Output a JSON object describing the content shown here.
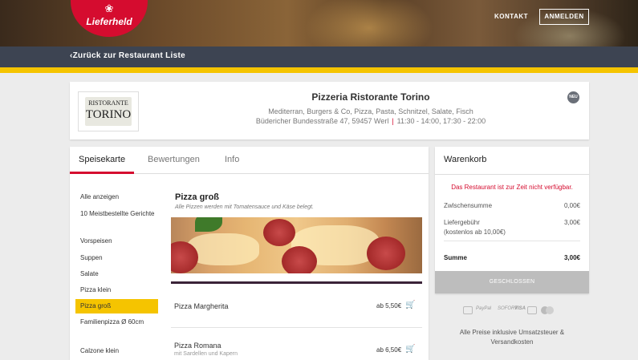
{
  "header": {
    "logo_text": "Lieferheld",
    "nav_kontakt": "KONTAKT",
    "nav_anmelden": "ANMELDEN",
    "back_link": "Zurück  zur  Restaurant  Liste",
    "accent_color": "#d50c2f",
    "highlight_color": "#f5c400"
  },
  "restaurant": {
    "logo_top": "RISTORANTE",
    "logo_main": "TORINO",
    "name": "Pizzeria Ristorante Torino",
    "tags": "Mediterran, Burgers & Co, Pizza, Pasta, Schnitzel, Salate, Fisch",
    "address": "Büdericher Bundesstraße 47, 59457 Werl",
    "hours": "11:30 - 14:00, 17:30 - 22:00",
    "new_badge": "NEU"
  },
  "tabs": [
    {
      "label": "Speisekarte"
    },
    {
      "label": "Bewertungen"
    },
    {
      "label": "Info"
    }
  ],
  "categories": [
    {
      "label": "Alle anzeigen"
    },
    {
      "label": "10 Meistbestellte Gerichte"
    },
    {
      "label": "Vorspeisen"
    },
    {
      "label": "Suppen"
    },
    {
      "label": "Salate"
    },
    {
      "label": "Pizza klein"
    },
    {
      "label": "Pizza groß"
    },
    {
      "label": "Familienpizza Ø 60cm"
    },
    {
      "label": "Calzone klein"
    }
  ],
  "section": {
    "title": "Pizza groß",
    "description": "Alle Pizzen werden mit Tomatensauce und Käse belegt."
  },
  "items": [
    {
      "name": "Pizza Margherita",
      "sub": "",
      "price": "ab 5,50€"
    },
    {
      "name": "Pizza Romana",
      "sub": "mit Sardellen und Kapern",
      "price": "ab 6,50€"
    }
  ],
  "cart": {
    "title": "Warenkorb",
    "closed_message": "Das Restaurant ist zur Zeit nicht verfügbar.",
    "subtotal_label": "Zwlschensumme",
    "subtotal_value": "0,00€",
    "delivery_label": "Liefergebühr",
    "delivery_sub": "(kostenlos ab 10,00€)",
    "delivery_value": "3,00€",
    "sum_label": "Summe",
    "sum_value": "3,00€",
    "button_label": "GESCHLOSSEN"
  },
  "payments": {
    "paypal": "PayPal",
    "sofort": "SOFORT",
    "visa": "VISA"
  },
  "price_note": "Alle Preise inklusive Umsatzsteuer & Versandkosten"
}
